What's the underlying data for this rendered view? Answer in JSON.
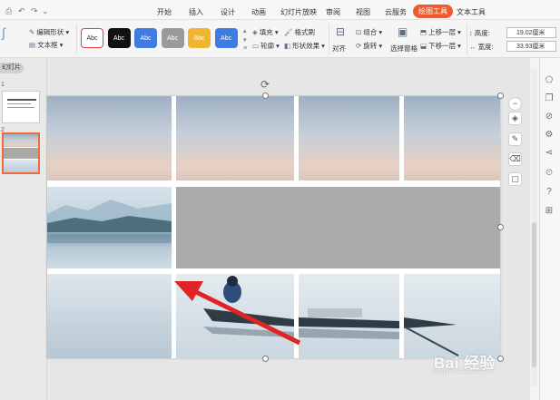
{
  "menu": {
    "items": [
      "开始",
      "插入",
      "设计",
      "动画",
      "幻灯片放映",
      "审阅",
      "视图",
      "云服务",
      "绘图工具",
      "文本工具"
    ],
    "active": "绘图工具",
    "active_color": "#ef5b2c"
  },
  "ribbon": {
    "edit_shape": "编辑形状",
    "textbox": "文本框",
    "style_label": "Abc",
    "styles": [
      {
        "bg": "#ffffff",
        "fg": "#333333",
        "border": "#e04040"
      },
      {
        "bg": "#111111",
        "fg": "#ffffff",
        "border": "#111111"
      },
      {
        "bg": "#3f7be0",
        "fg": "#ffffff",
        "border": "#3f7be0"
      },
      {
        "bg": "#9a9a9a",
        "fg": "#ffffff",
        "border": "#9a9a9a"
      },
      {
        "bg": "#f2b531",
        "fg": "#ffffff",
        "border": "#f2b531"
      },
      {
        "bg": "#3f7be0",
        "fg": "#ffffff",
        "border": "#3f7be0"
      }
    ],
    "fill": "填充",
    "format_brush": "格式刷",
    "outline": "轮廓",
    "shape_effect": "形状效果",
    "align": "对齐",
    "group": "组合",
    "rotate": "旋转",
    "selection_pane": "选择窗格",
    "bring_forward": "上移一层",
    "send_backward": "下移一层",
    "height_label": "高度:",
    "height_value": "19.02厘米",
    "width_label": "宽度:",
    "width_value": "33.93厘米"
  },
  "left_pane": {
    "tab_label": "幻灯片",
    "slide_nums": [
      "1",
      "2"
    ]
  },
  "watermark": {
    "main": "Bai 经验",
    "sub": "jingyan.baidu.com"
  }
}
